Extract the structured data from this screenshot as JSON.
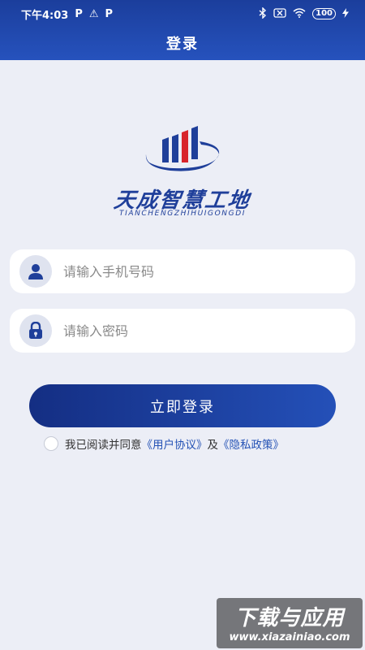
{
  "status_bar": {
    "time": "下午4:03",
    "left_icons": [
      "P",
      "⚠",
      "P"
    ],
    "battery": "100"
  },
  "header": {
    "title": "登录",
    "background_color": "#2148ad"
  },
  "logo": {
    "cn_text": "天成智慧工地",
    "en_text": "TIANCHENGZHIHUIGONGDI"
  },
  "form": {
    "phone_placeholder": "请输入手机号码",
    "password_placeholder": "请输入密码",
    "phone_icon": "user-icon",
    "password_icon": "lock-icon"
  },
  "login_button": {
    "label": "立即登录"
  },
  "agreement": {
    "prefix": "我已阅读并同意",
    "user_agreement": "《用户协议》",
    "conjunction": "及",
    "privacy_policy": "《隐私政策》",
    "checked": false
  },
  "watermark": {
    "cn": "下载与应用",
    "en": "www.xiazainiao.com"
  },
  "colors": {
    "accent": "#1f3f9a",
    "link": "#2452b5",
    "red_bar": "#d8242b",
    "background": "#eceef6"
  }
}
